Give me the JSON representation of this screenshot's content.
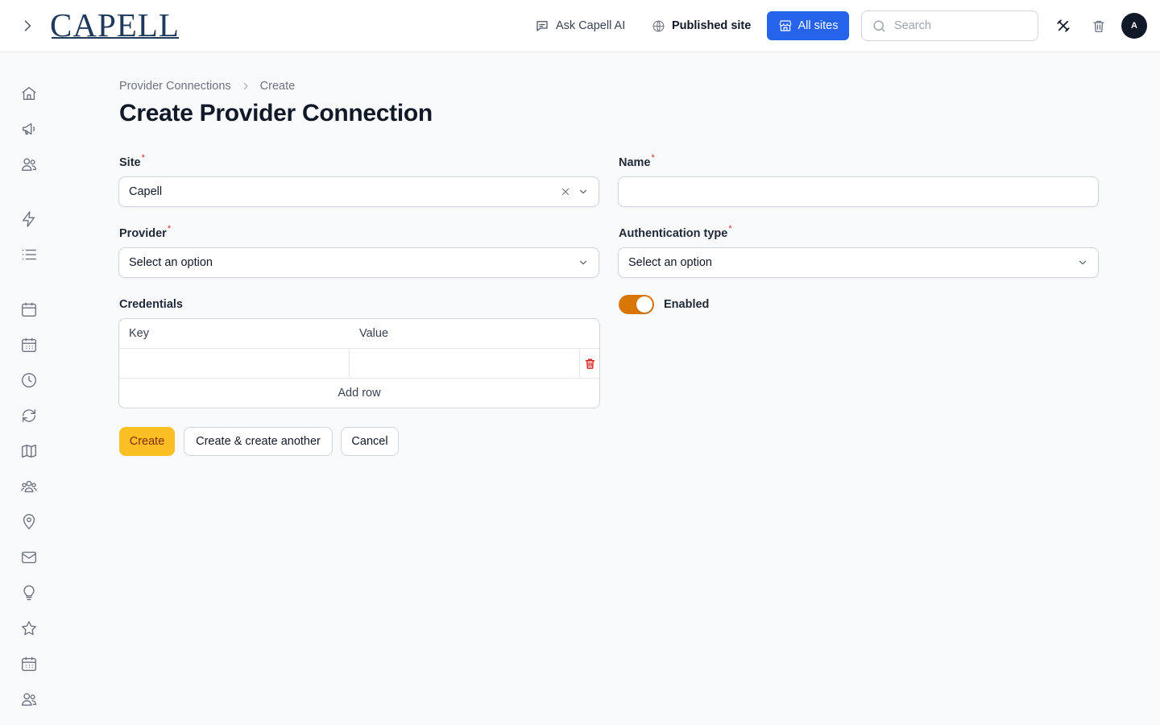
{
  "brand": {
    "logo_text": "CAPELL"
  },
  "topbar": {
    "ask_ai_label": "Ask Capell AI",
    "published_site_label": "Published site",
    "all_sites_label": "All sites",
    "search_placeholder": "Search",
    "avatar_initial": "A"
  },
  "breadcrumb": {
    "parent": "Provider Connections",
    "current": "Create"
  },
  "page": {
    "title": "Create Provider Connection"
  },
  "form": {
    "site": {
      "label": "Site",
      "required_mark": "*",
      "value": "Capell"
    },
    "name": {
      "label": "Name",
      "required_mark": "*",
      "value": ""
    },
    "provider": {
      "label": "Provider",
      "required_mark": "*",
      "value": "Select an option"
    },
    "auth_type": {
      "label": "Authentication type",
      "required_mark": "*",
      "value": "Select an option"
    },
    "credentials": {
      "label": "Credentials",
      "key_header": "Key",
      "value_header": "Value",
      "rows": [
        {
          "key": "",
          "value": ""
        }
      ],
      "add_row_label": "Add row"
    },
    "enabled": {
      "label": "Enabled",
      "checked": true
    }
  },
  "actions": {
    "create_label": "Create",
    "create_another_label": "Create & create another",
    "cancel_label": "Cancel"
  },
  "colors": {
    "accent_blue": "#2563eb",
    "primary_button": "#fbbf24",
    "toggle_on": "#d97706",
    "required": "#dc2626",
    "delete_icon": "#dc2626"
  },
  "sidebar_icons": [
    "home-icon",
    "megaphone-icon",
    "users-icon",
    "bolt-icon",
    "list-icon",
    "calendar-icon",
    "calendar-days-icon",
    "clock-icon",
    "refresh-icon",
    "map-icon",
    "user-group-icon",
    "map-pin-icon",
    "envelope-icon",
    "lightbulb-icon",
    "star-icon",
    "calendar-days-icon",
    "users-icon"
  ]
}
